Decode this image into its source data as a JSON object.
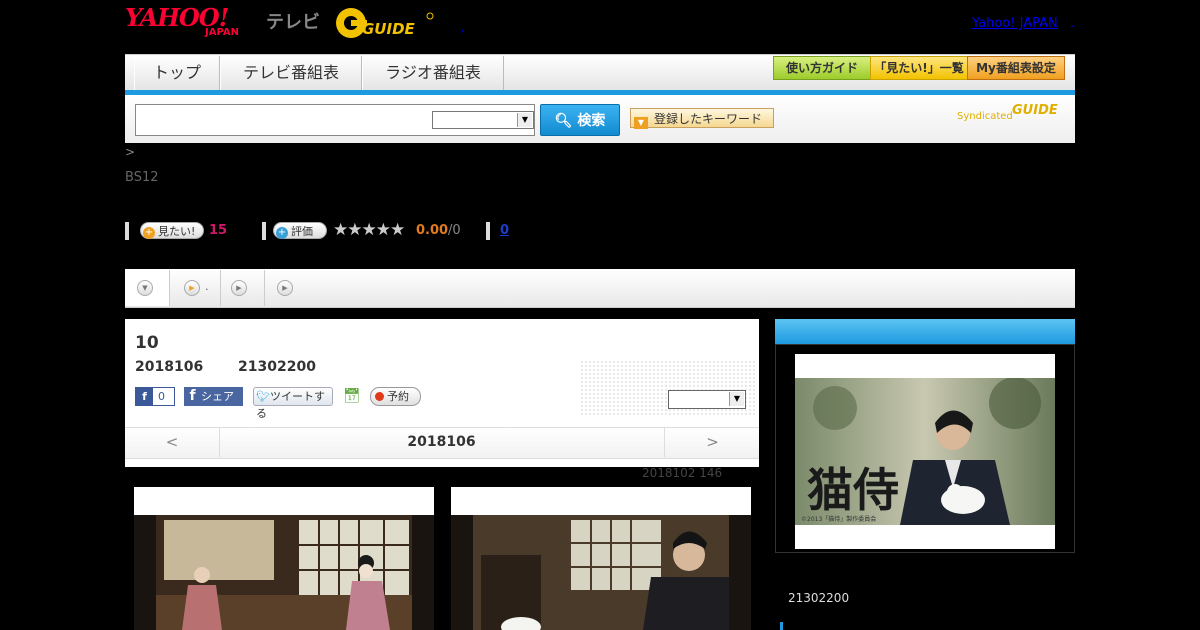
{
  "header": {
    "logo_yahoo": "YAHOO!",
    "logo_japan": "JAPAN",
    "logo_tv": "テレビ",
    "logo_gguide": "G GUIDE",
    "yahoo_japan_link": "Yahoo! JAPAN",
    "link_dot": ".",
    "comma_mark": ","
  },
  "nav": {
    "tabs": [
      {
        "label": "トップ"
      },
      {
        "label": "テレビ番組表"
      },
      {
        "label": "ラジオ番組表"
      }
    ],
    "guide_buttons": [
      {
        "label": "使い方ガイド"
      },
      {
        "label": "「見たい!」一覧"
      },
      {
        "label": "My番組表設定"
      }
    ]
  },
  "search": {
    "placeholder": "",
    "search_button": "検索",
    "keyword_button": "登録したキーワード",
    "syndicated": "Syndicated",
    "syndicated_logo": "GUIDE"
  },
  "program": {
    "breadcrumb": ">",
    "channel": "BS12",
    "want_label": "見たい!",
    "want_count": "15",
    "rate_label": "評価",
    "stars": "★★★★★",
    "rating": "0.00",
    "rating_den": "/0",
    "link_count": "0"
  },
  "subnav": {
    "tab2_label": "."
  },
  "episode": {
    "number": "10",
    "date": "2018106",
    "time": "21302200",
    "fb_count": "0",
    "share_label": "シェア",
    "tweet_label": "ツイートする",
    "reserve_label": "予約",
    "pager_prev": "<",
    "pager_date": "2018106",
    "pager_next": ">",
    "note": "2018102 146"
  },
  "side": {
    "title_art": "猫侍",
    "copyright": "©2013「猫侍」製作委員会",
    "time": "21302200"
  },
  "colors": {
    "accent": "#1e9ae0",
    "brand_red": "#ff0033",
    "gguide_yellow": "#f2c200"
  }
}
